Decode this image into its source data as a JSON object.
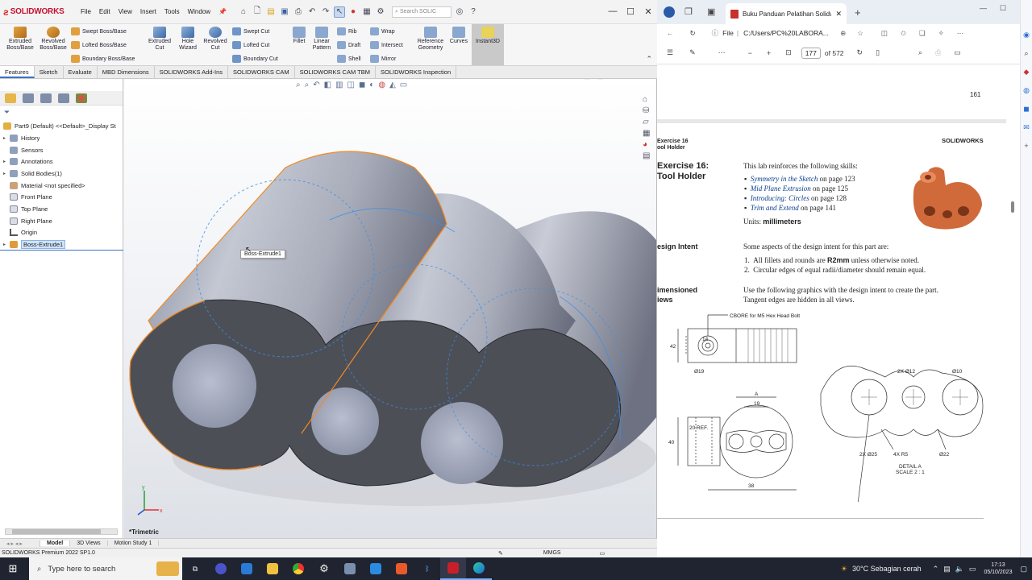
{
  "solidworks": {
    "logo": "SOLIDWORKS",
    "menu": [
      "File",
      "Edit",
      "View",
      "Insert",
      "Tools",
      "Window"
    ],
    "search_placeholder": "Search SOLIC",
    "ribbon": {
      "extruded_boss": "Extruded Boss/Base",
      "revolved_boss": "Revolved Boss/Base",
      "swept_boss": "Swept Boss/Base",
      "lofted_boss": "Lofted Boss/Base",
      "boundary_boss": "Boundary Boss/Base",
      "extruded_cut": "Extruded Cut",
      "hole_wizard": "Hole Wizard",
      "revolved_cut": "Revolved Cut",
      "swept_cut": "Swept Cut",
      "lofted_cut": "Lofted Cut",
      "boundary_cut": "Boundary Cut",
      "fillet": "Fillet",
      "linear_pattern": "Linear Pattern",
      "rib": "Rib",
      "draft": "Draft",
      "shell": "Shell",
      "wrap": "Wrap",
      "intersect": "Intersect",
      "mirror": "Mirror",
      "reference_geometry": "Reference Geometry",
      "curves": "Curves",
      "instant3d": "Instant3D"
    },
    "command_tabs": [
      "Features",
      "Sketch",
      "Evaluate",
      "MBD Dimensions",
      "SOLIDWORKS Add-Ins",
      "SOLIDWORKS CAM",
      "SOLIDWORKS CAM TBM",
      "SOLIDWORKS Inspection"
    ],
    "tree": {
      "root": "Part9 (Default) <<Default>_Display St",
      "items": [
        "History",
        "Sensors",
        "Annotations",
        "Solid Bodies(1)",
        "Material <not specified>",
        "Front Plane",
        "Top Plane",
        "Right Plane",
        "Origin",
        "Boss-Extrude1"
      ]
    },
    "tooltip": "Boss-Extrude1",
    "view_label": "*Trimetric",
    "bottom_tabs": [
      "Model",
      "3D Views",
      "Motion Study 1"
    ],
    "status_left": "SOLIDWORKS Premium 2022 SP1.0",
    "status_units": "MMGS"
  },
  "edge": {
    "tab_title": "Buku Panduan Pelatihan Solidw",
    "address_prefix": "File",
    "address": "C:/Users/PC%20LABORA...",
    "page_current": "177",
    "page_total": "of 572"
  },
  "pdf": {
    "page_number": "161",
    "header": "SOLIDWORKS",
    "exercise_small": "Exercise 16",
    "exercise_small2": "ool Holder",
    "exercise_title1": "Exercise 16:",
    "exercise_title2": "Tool Holder",
    "intro": "This lab reinforces the following skills:",
    "skills": [
      {
        "name": "Symmetry in the Sketch",
        "page": " on page 123"
      },
      {
        "name": "Mid Plane Extrusion",
        "page": " on page 125"
      },
      {
        "name": "Introducing: Circles",
        "page": " on page 128"
      },
      {
        "name": "Trim and Extend",
        "page": " on page 141"
      }
    ],
    "units_label": "Units: ",
    "units_value": "millimeters",
    "design_intent_heading": "esign Intent",
    "design_intent_text": "Some aspects of the design intent for this part are:",
    "intent_1a": "All fillets and rounds are ",
    "intent_1b": "R2mm",
    "intent_1c": " unless otherwise noted.",
    "intent_2": "Circular edges of equal radii/diameter should remain equal.",
    "dimensioned_heading1": "imensioned",
    "dimensioned_heading2": "iews",
    "dimensioned_text1": "Use the following graphics with the design intent to create the part.",
    "dimensioned_text2": "Tangent edges are hidden in all views.",
    "drawing_labels": {
      "cbore": "CBORE for M5 Hex Head Bolt",
      "d14": "14",
      "d42": "42",
      "d19": "Ø19",
      "d20ref": "20 REF.",
      "d40": "40",
      "dA": "A",
      "d19b": "19",
      "d38": "38",
      "d2x12": "2X Ø12",
      "d10": "Ø10",
      "d2x25": "2X Ø25",
      "d4xr5": "4X R5",
      "d22": "Ø22",
      "detail": "DETAIL A",
      "scale": "SCALE 2 : 1"
    }
  },
  "taskbar": {
    "search_placeholder": "Type here to search",
    "weather": "30°C  Sebagian cerah",
    "time": "17:13",
    "date": "05/10/2023"
  },
  "colors": {
    "sw_red": "#d8232a",
    "model_dark": "#4d4f57",
    "model_light": "#b9bdc9",
    "selection_orange": "#f08a24",
    "selection_blue": "#3d8fe6"
  }
}
